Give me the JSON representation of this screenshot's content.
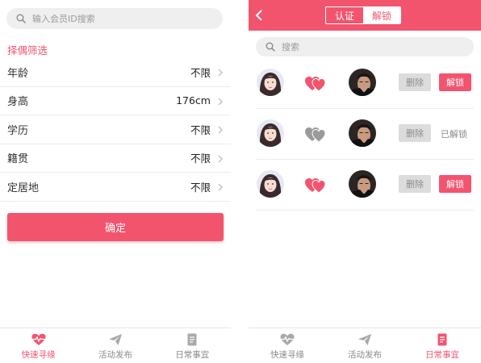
{
  "left": {
    "search": {
      "placeholder": "输入会员ID搜索"
    },
    "section_title": "择偶筛选",
    "filters": [
      {
        "label": "年龄",
        "value": "不限"
      },
      {
        "label": "身高",
        "value": "176cm"
      },
      {
        "label": "学历",
        "value": "不限"
      },
      {
        "label": "籍贯",
        "value": "不限"
      },
      {
        "label": "定居地",
        "value": "不限"
      }
    ],
    "confirm_label": "确定",
    "tabs": [
      {
        "label": "快速寻缘",
        "icon": "heartbeat-icon",
        "active": true
      },
      {
        "label": "活动发布",
        "icon": "paper-plane-icon",
        "active": false
      },
      {
        "label": "日常事宜",
        "icon": "note-icon",
        "active": false
      }
    ]
  },
  "right": {
    "segments": [
      {
        "label": "认证",
        "active": false
      },
      {
        "label": "解锁",
        "active": true
      }
    ],
    "search": {
      "placeholder": "搜索"
    },
    "rows": [
      {
        "heart": "red",
        "delete_label": "删除",
        "action_label": "解锁",
        "unlocked": false
      },
      {
        "heart": "gray",
        "delete_label": "删除",
        "action_label": "已解锁",
        "unlocked": true
      },
      {
        "heart": "red",
        "delete_label": "删除",
        "action_label": "解锁",
        "unlocked": false
      }
    ],
    "tabs": [
      {
        "label": "快速寻缘",
        "icon": "heartbeat-icon",
        "active": false
      },
      {
        "label": "活动发布",
        "icon": "paper-plane-icon",
        "active": false
      },
      {
        "label": "日常事宜",
        "icon": "note-icon",
        "active": true
      }
    ]
  },
  "colors": {
    "accent": "#f2546e",
    "heart_gray": "#9a9a9a",
    "muted": "#8a8a8a"
  }
}
